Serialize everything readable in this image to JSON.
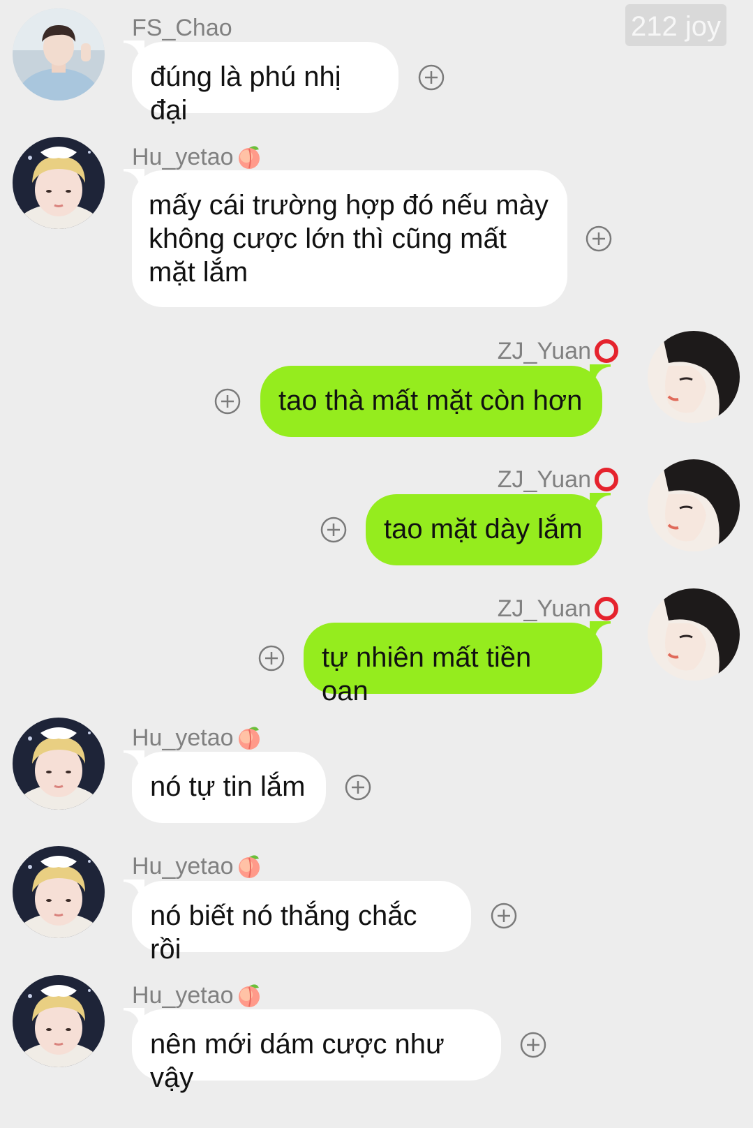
{
  "watermark": "212 joy",
  "messages": [
    {
      "sender": "FS_Chao",
      "side": "left",
      "text": "đúng là phú nhị đại",
      "avatar": "avatar-fs-chao"
    },
    {
      "sender": "Hu_yetao",
      "side": "left",
      "emoji": "peach-emoji",
      "text": "mấy cái trường hợp đó nếu mày không cược lớn thì cũng mất mặt lắm",
      "avatar": "avatar-hu-yetao"
    },
    {
      "sender": "ZJ_Yuan",
      "side": "right",
      "emoji": "red-circle-emoji",
      "text": "tao thà mất mặt còn hơn",
      "avatar": "avatar-zj-yuan"
    },
    {
      "sender": "ZJ_Yuan",
      "side": "right",
      "emoji": "red-circle-emoji",
      "text": "tao mặt dày lắm",
      "avatar": "avatar-zj-yuan"
    },
    {
      "sender": "ZJ_Yuan",
      "side": "right",
      "emoji": "red-circle-emoji",
      "text": "tự nhiên mất tiền oan",
      "avatar": "avatar-zj-yuan"
    },
    {
      "sender": "Hu_yetao",
      "side": "left",
      "emoji": "peach-emoji",
      "text": "nó tự tin lắm",
      "avatar": "avatar-hu-yetao"
    },
    {
      "sender": "Hu_yetao",
      "side": "left",
      "emoji": "peach-emoji",
      "text": "nó biết nó thắng chắc rồi",
      "avatar": "avatar-hu-yetao"
    },
    {
      "sender": "Hu_yetao",
      "side": "left",
      "emoji": "peach-emoji",
      "text": "nên mới dám cược như vậy",
      "avatar": "avatar-hu-yetao"
    }
  ],
  "colors": {
    "background": "#ededed",
    "incoming_bubble": "#ffffff",
    "outgoing_bubble": "#95ec1e",
    "sender_name": "#808080"
  }
}
